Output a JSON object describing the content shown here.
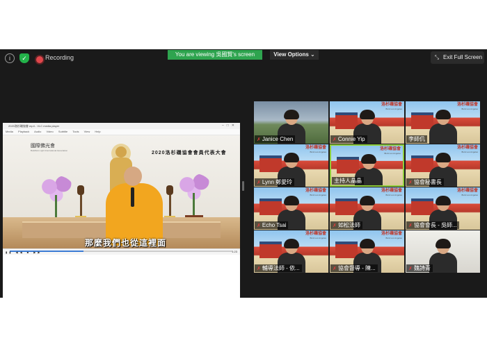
{
  "topbar": {
    "recording_label": "Recording",
    "viewing_banner": "You are viewing 吳國賢's screen",
    "view_options_label": "View Options ⌄",
    "exit_fullscreen_label": "Exit Full Screen"
  },
  "shared_screen": {
    "player_title": "2020洛杉磯協會.mp4 - VLC media player",
    "player_menu": [
      "Media",
      "Playback",
      "Audio",
      "Video",
      "Subtitle",
      "Tools",
      "View",
      "Help"
    ],
    "logo_text": "國際佛光會",
    "logo_subtext": "Buddha's Light International Association",
    "event_title": "2020洛杉磯協會會員代表大會",
    "subtitle": "那麼我們也從這裡面",
    "progress_fraction": 0.33,
    "time_label": "1:23"
  },
  "participants": [
    {
      "name": "Janice Chen",
      "muted": true,
      "background": "sky"
    },
    {
      "name": "Connie Yip",
      "muted": true,
      "background": "temple"
    },
    {
      "name": "李師仉",
      "muted": false,
      "background": "temple"
    },
    {
      "name": "Lynn 鄭愛玲",
      "muted": true,
      "background": "temple"
    },
    {
      "name": "主持人晶晶",
      "muted": false,
      "background": "temple",
      "speaking": true
    },
    {
      "name": "協會秘書長",
      "muted": true,
      "background": "temple"
    },
    {
      "name": "Echo Tsai",
      "muted": true,
      "background": "temple"
    },
    {
      "name": "如松法師",
      "muted": true,
      "background": "temple"
    },
    {
      "name": "協會會長 - 吳師...",
      "muted": true,
      "background": "temple"
    },
    {
      "name": "輔導法師 - 依...",
      "muted": true,
      "background": "temple"
    },
    {
      "name": "協會督導 - 陳...",
      "muted": true,
      "background": "temple"
    },
    {
      "name": "魏詩青",
      "muted": true,
      "background": "room"
    }
  ],
  "brand": {
    "name": "洛杉磯協會",
    "sub": "BLIA Los Angeles"
  },
  "colors": {
    "recording": "#e0464b",
    "banner": "#2ea44f",
    "speaking_border": "#8fce3a",
    "app_bg": "#1a1a1a"
  }
}
